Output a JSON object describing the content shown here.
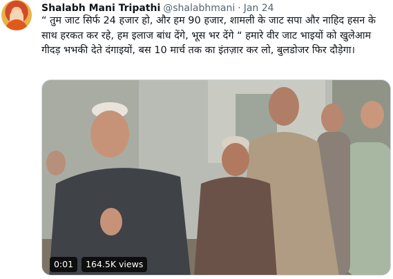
{
  "tweet": {
    "author": {
      "display_name": "Shalabh Mani Tripathi",
      "handle": "@shalabhmani",
      "separator": "·",
      "date": "Jan 24"
    },
    "text": "“ तुम जाट सिर्फ 24 हजार हो, और हम 90 हजार, शामली के जाट सपा और नाहिद हसन के साथ हरकत कर रहे, हम इलाज बांध देंगे, भूस भर देंगे “ हमारे वीर जाट भाइयों को खुलेआम गीदड़ भभकी देते दंगाइयों, बस 10 मार्च तक का इंतज़ार कर लो, बुलडोजर फिर दौड़ेगा।",
    "media": {
      "type": "video",
      "elapsed": "0:01",
      "views": "164.5K views"
    }
  }
}
